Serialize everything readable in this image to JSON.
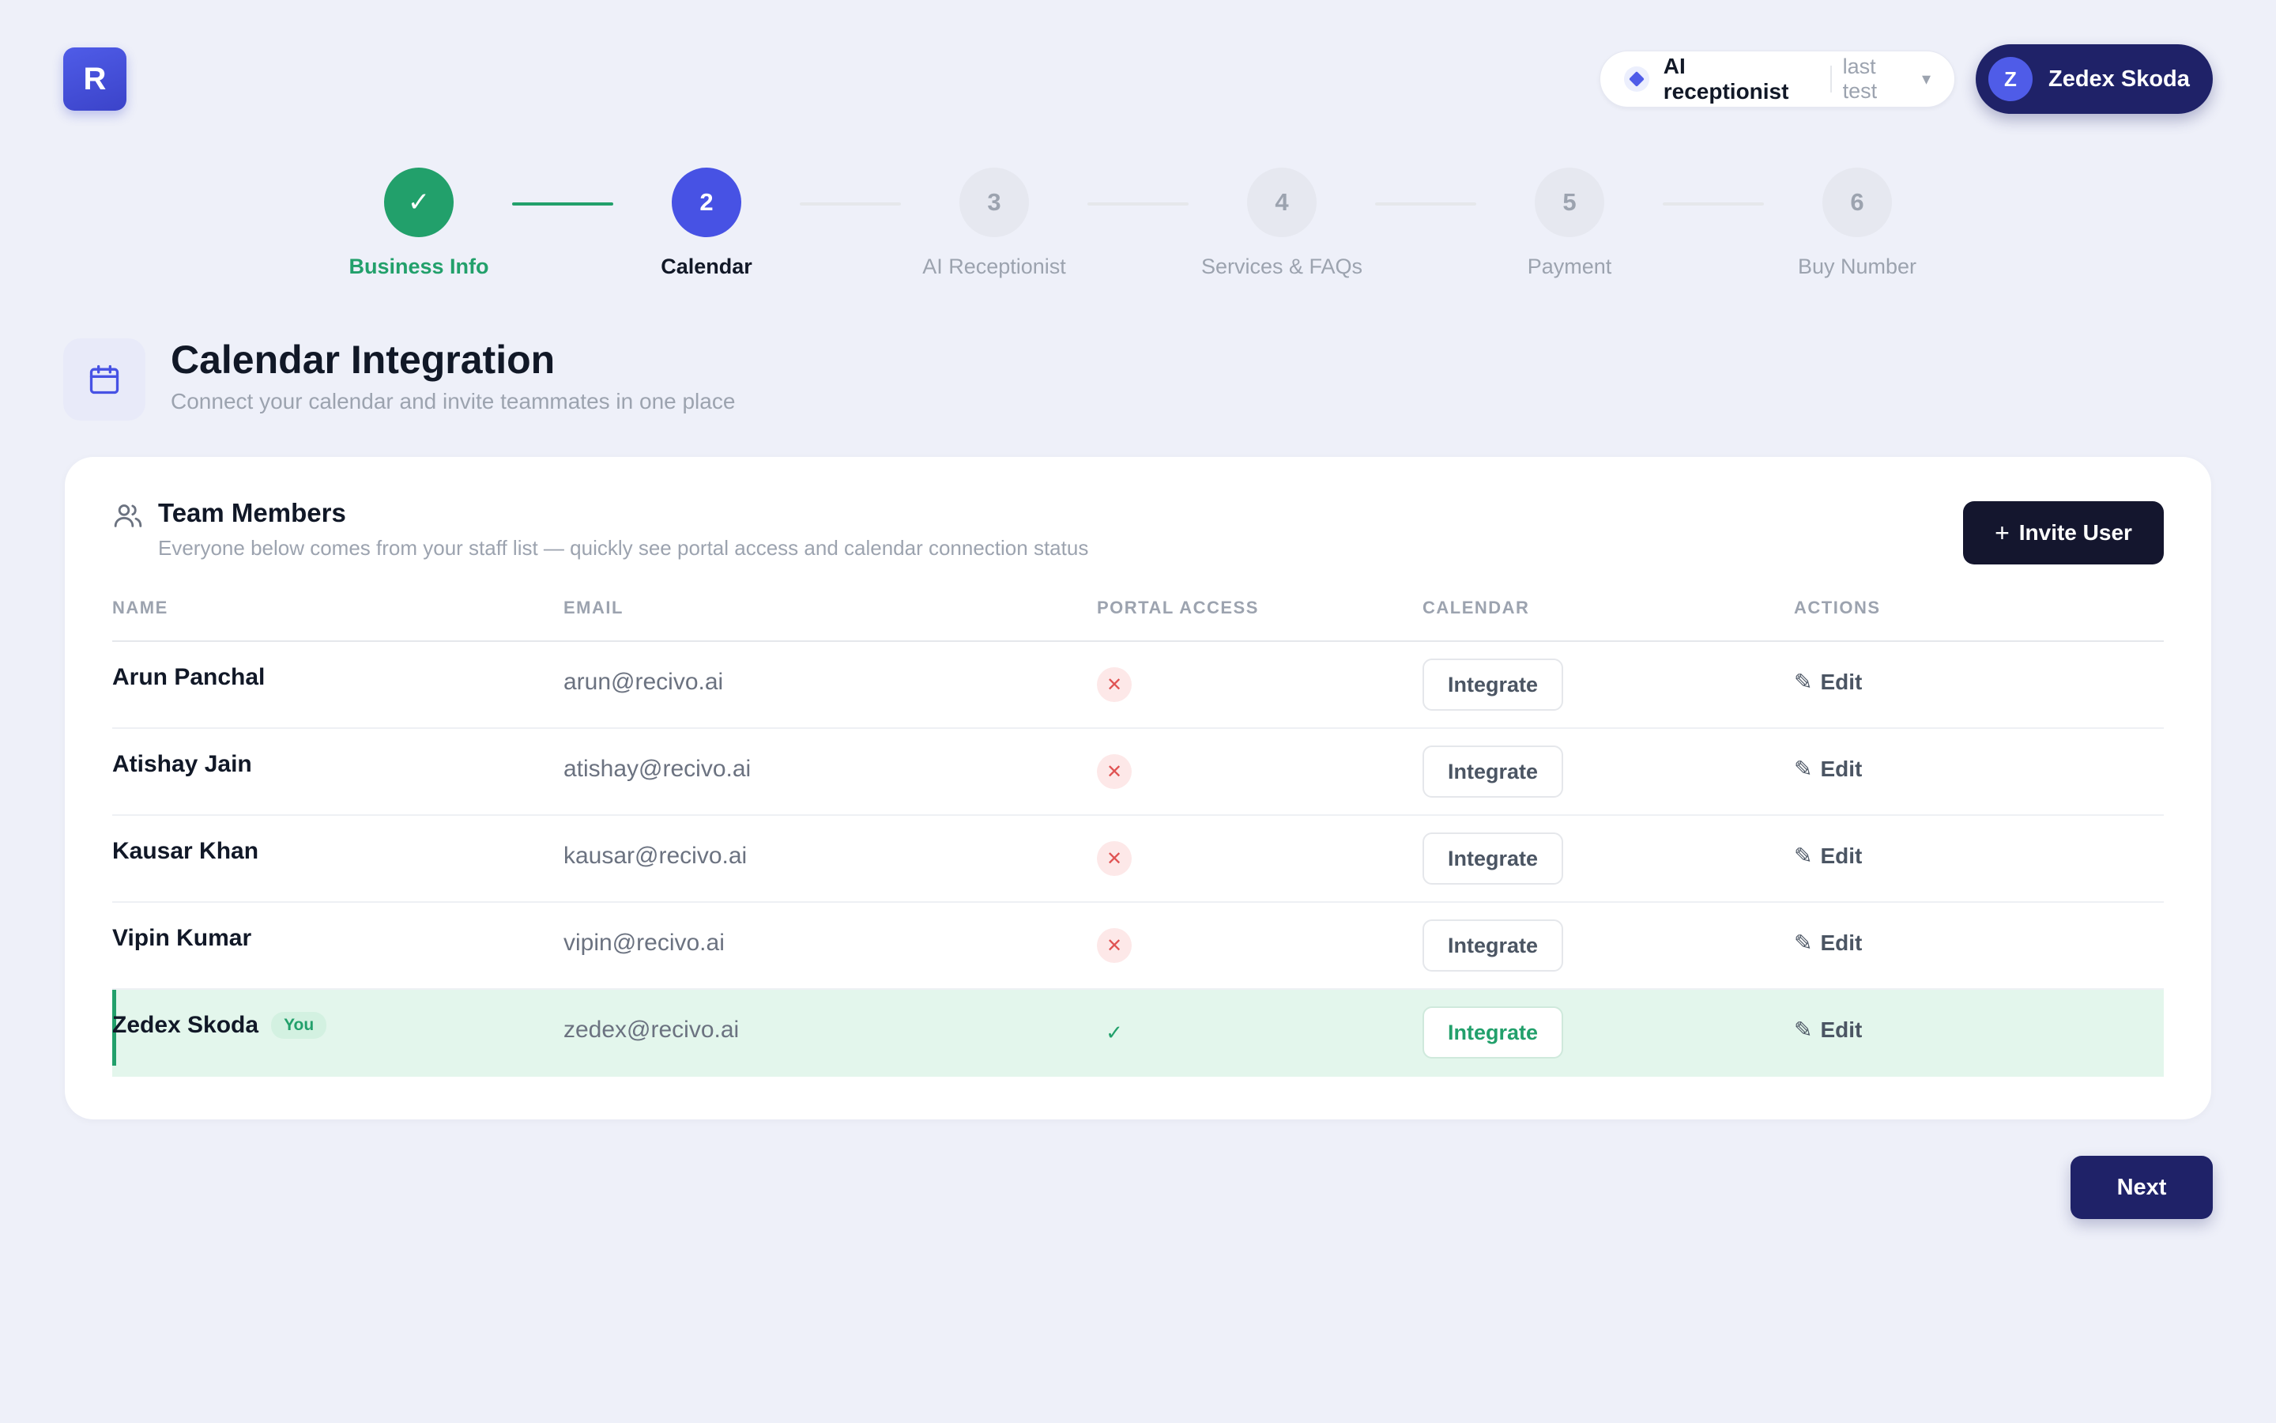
{
  "app": {
    "logo_letter": "R"
  },
  "header": {
    "agent_name": "AI receptionist",
    "agent_sub": "last test",
    "user_initial": "Z",
    "user_name": "Zedex Skoda"
  },
  "stepper": {
    "steps": [
      {
        "number": "✓",
        "label": "Business Info",
        "state": "done"
      },
      {
        "number": "2",
        "label": "Calendar",
        "state": "active"
      },
      {
        "number": "3",
        "label": "AI Receptionist",
        "state": "pending"
      },
      {
        "number": "4",
        "label": "Services & FAQs",
        "state": "pending"
      },
      {
        "number": "5",
        "label": "Payment",
        "state": "pending"
      },
      {
        "number": "6",
        "label": "Buy Number",
        "state": "pending"
      }
    ]
  },
  "section": {
    "title": "Calendar Integration",
    "subtitle": "Connect your calendar and invite teammates in one place"
  },
  "team": {
    "title": "Team Members",
    "subtitle": "Everyone below comes from your staff list — quickly see portal access and calendar connection status",
    "invite_label": "Invite User",
    "columns": {
      "name": "NAME",
      "email": "EMAIL",
      "portal": "PORTAL ACCESS",
      "calendar": "CALENDAR",
      "actions": "ACTIONS"
    },
    "rows": [
      {
        "name": "Arun Panchal",
        "email": "arun@recivo.ai",
        "portal_access": false,
        "integrate": "Integrate",
        "edit": "Edit"
      },
      {
        "name": "Atishay Jain",
        "email": "atishay@recivo.ai",
        "portal_access": false,
        "integrate": "Integrate",
        "edit": "Edit"
      },
      {
        "name": "Kausar Khan",
        "email": "kausar@recivo.ai",
        "portal_access": false,
        "integrate": "Integrate",
        "edit": "Edit"
      },
      {
        "name": "Vipin Kumar",
        "email": "vipin@recivo.ai",
        "portal_access": false,
        "integrate": "Integrate",
        "edit": "Edit"
      },
      {
        "name": "Zedex Skoda",
        "email": "zedex@recivo.ai",
        "portal_access": true,
        "integrate": "Integrate",
        "edit": "Edit",
        "you_badge": "You"
      }
    ]
  },
  "footer": {
    "next_label": "Next"
  },
  "colors": {
    "accent": "#4752e4",
    "success": "#22a06b",
    "navy": "#1f2268",
    "danger": "#e05252"
  }
}
